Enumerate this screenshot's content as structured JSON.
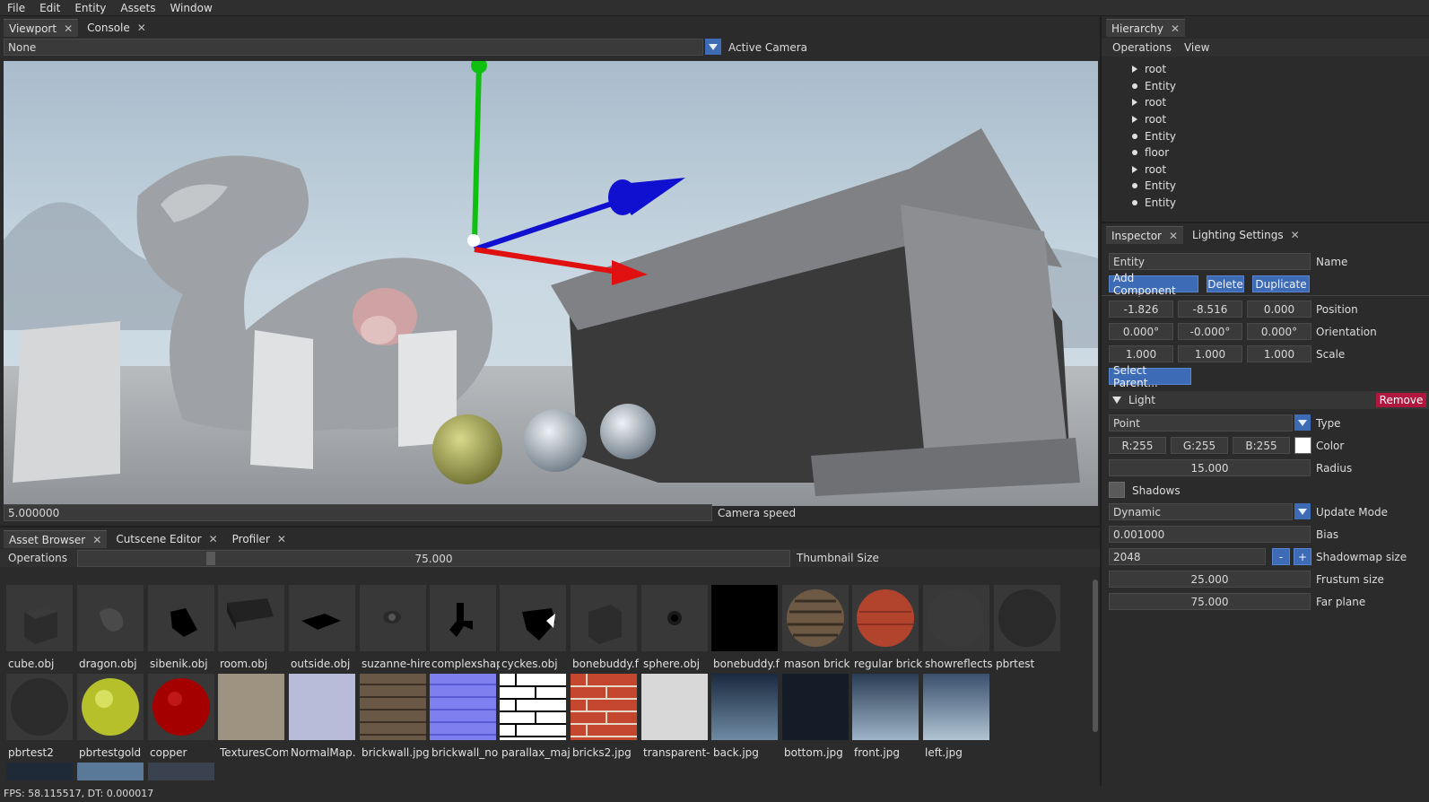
{
  "menu": [
    "File",
    "Edit",
    "Entity",
    "Assets",
    "Window"
  ],
  "viewport": {
    "tabs": [
      {
        "label": "Viewport",
        "close": "✕"
      },
      {
        "label": "Console",
        "close": "✕"
      }
    ],
    "camera_select": "None",
    "camera_label": "Active Camera",
    "camera_speed_value": "5.000000",
    "camera_speed_label": "Camera speed"
  },
  "hierarchy": {
    "tab": "Hierarchy",
    "close": "✕",
    "menu": [
      "Operations",
      "View"
    ],
    "items": [
      {
        "label": "root",
        "kind": "triangle"
      },
      {
        "label": "Entity",
        "kind": "dot"
      },
      {
        "label": "root",
        "kind": "triangle"
      },
      {
        "label": "root",
        "kind": "triangle"
      },
      {
        "label": "Entity",
        "kind": "dot"
      },
      {
        "label": "floor",
        "kind": "dot"
      },
      {
        "label": "root",
        "kind": "triangle"
      },
      {
        "label": "Entity",
        "kind": "dot"
      },
      {
        "label": "Entity",
        "kind": "dot"
      }
    ]
  },
  "inspector": {
    "tabs": [
      {
        "label": "Inspector",
        "close": "✕"
      },
      {
        "label": "Lighting Settings",
        "close": "✕"
      }
    ],
    "name_value": "Entity",
    "name_label": "Name",
    "add_component": "Add Component",
    "delete": "Delete",
    "duplicate": "Duplicate",
    "position": [
      "-1.826",
      "-8.516",
      "0.000"
    ],
    "position_label": "Position",
    "orientation": [
      "0.000°",
      "-0.000°",
      "0.000°"
    ],
    "orientation_label": "Orientation",
    "scale": [
      "1.000",
      "1.000",
      "1.000"
    ],
    "scale_label": "Scale",
    "select_parent": "Select Parent...",
    "light": {
      "header": "Light",
      "remove": "Remove",
      "type_value": "Point",
      "type_label": "Type",
      "color": [
        "R:255",
        "G:255",
        "B:255"
      ],
      "color_label": "Color",
      "color_swatch": "#ffffff",
      "radius_value": "15.000",
      "radius_label": "Radius",
      "shadows_label": "Shadows",
      "update_mode_value": "Dynamic",
      "update_mode_label": "Update Mode",
      "bias_value": "0.001000",
      "bias_label": "Bias",
      "shadowmap_value": "2048",
      "shadowmap_minus": "-",
      "shadowmap_plus": "+",
      "shadowmap_label": "Shadowmap size",
      "frustum_value": "25.000",
      "frustum_label": "Frustum size",
      "far_value": "75.000",
      "far_label": "Far plane"
    }
  },
  "assets": {
    "tabs": [
      {
        "label": "Asset Browser",
        "close": "✕"
      },
      {
        "label": "Cutscene Editor",
        "close": "✕"
      },
      {
        "label": "Profiler",
        "close": "✕"
      }
    ],
    "operations": "Operations",
    "thumb_size_value": "75.000",
    "thumb_size_fraction": 0.18,
    "thumb_size_label": "Thumbnail Size",
    "row1": [
      "cube.obj",
      "dragon.obj",
      "sibenik.obj",
      "room.obj",
      "outside.obj",
      "suzanne-hire",
      "complexshap",
      "cyckes.obj",
      "bonebuddy.f",
      "sphere.obj",
      "bonebuddy.f",
      "mason brick",
      "regular brick",
      "showreflects",
      "pbrtest"
    ],
    "row2": [
      "pbrtest2",
      "pbrtestgold",
      "copper",
      "TexturesCom",
      "NormalMap.",
      "brickwall.jpg",
      "brickwall_no",
      "parallax_maj",
      "bricks2.jpg",
      "transparent-",
      "back.jpg",
      "bottom.jpg",
      "front.jpg",
      "left.jpg"
    ]
  },
  "status": "FPS: 58.115517, DT: 0.000017",
  "colors": {
    "accent": "#3d6bb5",
    "remove": "#b0173f",
    "gizmo_x": "#e01010",
    "gizmo_y": "#10c010",
    "gizmo_z": "#1010d0"
  }
}
